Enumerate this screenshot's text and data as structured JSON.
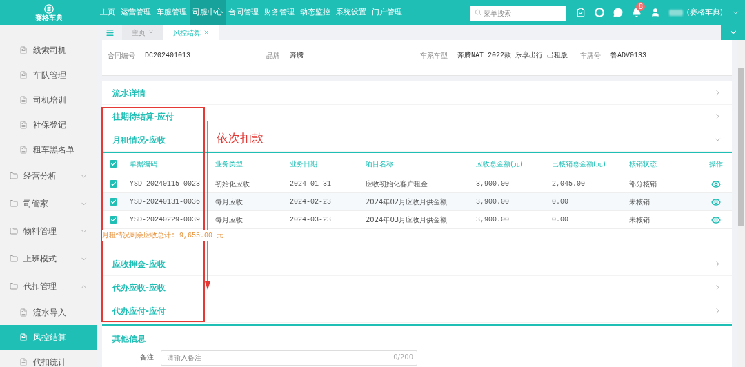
{
  "header": {
    "logo_text": "赛格车典",
    "nav": [
      {
        "label": "主页",
        "selected": false
      },
      {
        "label": "运营管理",
        "selected": false
      },
      {
        "label": "车服管理",
        "selected": false
      },
      {
        "label": "司服中心",
        "selected": true
      },
      {
        "label": "合同管理",
        "selected": false
      },
      {
        "label": "财务管理",
        "selected": false
      },
      {
        "label": "动态监控",
        "selected": false
      },
      {
        "label": "系统设置",
        "selected": false
      },
      {
        "label": "门户管理",
        "selected": false
      }
    ],
    "search": {
      "placeholder": "菜单搜索"
    },
    "notification_count": "8",
    "user_org": "(赛格车典)"
  },
  "sidebar": {
    "items": [
      {
        "kind": "page",
        "label": "线索司机",
        "selected": false
      },
      {
        "kind": "page",
        "label": "车队管理",
        "selected": false
      },
      {
        "kind": "page",
        "label": "司机培训",
        "selected": false
      },
      {
        "kind": "page",
        "label": "社保登记",
        "selected": false
      },
      {
        "kind": "page",
        "label": "租车黑名单",
        "selected": false
      },
      {
        "kind": "group",
        "label": "经营分析",
        "expanded": false
      },
      {
        "kind": "group",
        "label": "司管家",
        "expanded": false
      },
      {
        "kind": "group",
        "label": "物料管理",
        "expanded": false
      },
      {
        "kind": "group",
        "label": "上班模式",
        "expanded": false
      },
      {
        "kind": "group",
        "label": "代扣管理",
        "expanded": true,
        "children": [
          {
            "kind": "page",
            "label": "流水导入",
            "selected": false
          },
          {
            "kind": "page",
            "label": "风控结算",
            "selected": true
          },
          {
            "kind": "page",
            "label": "代扣统计",
            "selected": false
          }
        ]
      }
    ]
  },
  "tabs": [
    {
      "label": "主页",
      "selected": false
    },
    {
      "label": "风控结算",
      "selected": true
    }
  ],
  "contract": [
    {
      "label": "合同编号",
      "value": "DC202401013"
    },
    {
      "label": "品牌",
      "value": "奔腾"
    },
    {
      "label": "车系车型",
      "value": "奔腾NAT 2022款 乐享出行 出租版"
    },
    {
      "label": "车牌号",
      "value": "鲁ADV0133"
    }
  ],
  "sections": [
    {
      "title": "流水详情",
      "expanded": false
    },
    {
      "title": "往期待结算-应付",
      "expanded": false
    },
    {
      "title": "月租情况-应收",
      "expanded": true,
      "table": {
        "all_checked": true,
        "columns": [
          "单据编码",
          "业务类型",
          "业务日期",
          "项目名称",
          "应收总金额(元)",
          "已核销总金额(元)",
          "核销状态",
          "操作"
        ],
        "rows": [
          {
            "checked": true,
            "cells": [
              "YSD-20240115-0023",
              "初始化应收",
              "2024-01-31",
              "应收初始化客户租金",
              "3,900.00",
              "2,045.00",
              "部分核销"
            ]
          },
          {
            "checked": true,
            "cells": [
              "YSD-20240131-0036",
              "每月应收",
              "2024-02-23",
              "2024年02月应收月供金额",
              "3,900.00",
              "0.00",
              "未核销"
            ]
          },
          {
            "checked": true,
            "cells": [
              "YSD-20240229-0039",
              "每月应收",
              "2024-03-23",
              "2024年03月应收月供金额",
              "3,900.00",
              "0.00",
              "未核销"
            ]
          }
        ],
        "summary": "月租情况剩余应收总计: 9,655.00 元"
      }
    },
    {
      "title": "应收押金-应收",
      "expanded": false
    },
    {
      "title": "代办应收-应收",
      "expanded": false
    },
    {
      "title": "代办应付-应付",
      "expanded": false
    }
  ],
  "annotation": {
    "text": "依次扣款"
  },
  "other_info": {
    "title": "其他信息",
    "remark_label": "备注",
    "remark_placeholder": "请输入备注",
    "remark_counter": "0/200"
  }
}
